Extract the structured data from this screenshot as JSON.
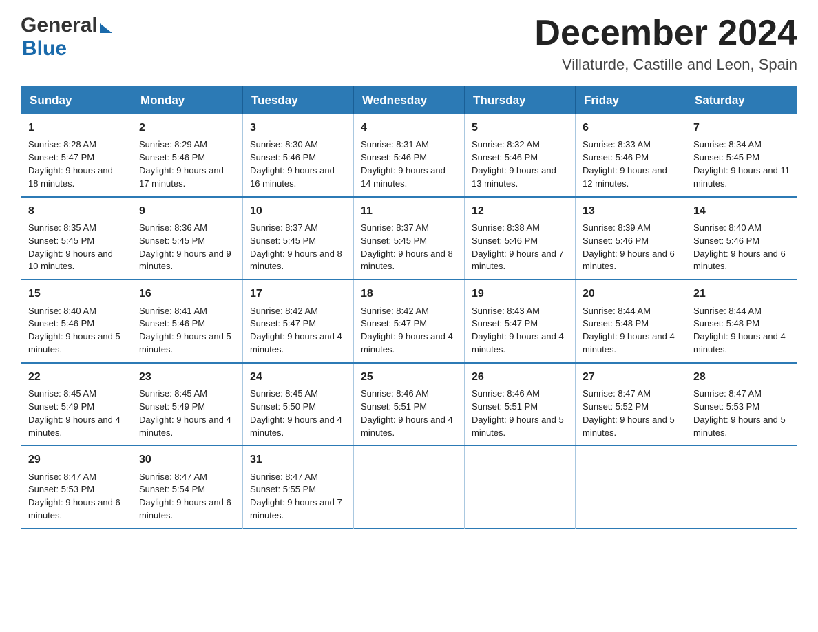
{
  "header": {
    "logo_general": "General",
    "logo_blue": "Blue",
    "month_title": "December 2024",
    "location": "Villaturde, Castille and Leon, Spain"
  },
  "weekdays": [
    "Sunday",
    "Monday",
    "Tuesday",
    "Wednesday",
    "Thursday",
    "Friday",
    "Saturday"
  ],
  "weeks": [
    [
      {
        "day": "1",
        "sunrise": "Sunrise: 8:28 AM",
        "sunset": "Sunset: 5:47 PM",
        "daylight": "Daylight: 9 hours and 18 minutes."
      },
      {
        "day": "2",
        "sunrise": "Sunrise: 8:29 AM",
        "sunset": "Sunset: 5:46 PM",
        "daylight": "Daylight: 9 hours and 17 minutes."
      },
      {
        "day": "3",
        "sunrise": "Sunrise: 8:30 AM",
        "sunset": "Sunset: 5:46 PM",
        "daylight": "Daylight: 9 hours and 16 minutes."
      },
      {
        "day": "4",
        "sunrise": "Sunrise: 8:31 AM",
        "sunset": "Sunset: 5:46 PM",
        "daylight": "Daylight: 9 hours and 14 minutes."
      },
      {
        "day": "5",
        "sunrise": "Sunrise: 8:32 AM",
        "sunset": "Sunset: 5:46 PM",
        "daylight": "Daylight: 9 hours and 13 minutes."
      },
      {
        "day": "6",
        "sunrise": "Sunrise: 8:33 AM",
        "sunset": "Sunset: 5:46 PM",
        "daylight": "Daylight: 9 hours and 12 minutes."
      },
      {
        "day": "7",
        "sunrise": "Sunrise: 8:34 AM",
        "sunset": "Sunset: 5:45 PM",
        "daylight": "Daylight: 9 hours and 11 minutes."
      }
    ],
    [
      {
        "day": "8",
        "sunrise": "Sunrise: 8:35 AM",
        "sunset": "Sunset: 5:45 PM",
        "daylight": "Daylight: 9 hours and 10 minutes."
      },
      {
        "day": "9",
        "sunrise": "Sunrise: 8:36 AM",
        "sunset": "Sunset: 5:45 PM",
        "daylight": "Daylight: 9 hours and 9 minutes."
      },
      {
        "day": "10",
        "sunrise": "Sunrise: 8:37 AM",
        "sunset": "Sunset: 5:45 PM",
        "daylight": "Daylight: 9 hours and 8 minutes."
      },
      {
        "day": "11",
        "sunrise": "Sunrise: 8:37 AM",
        "sunset": "Sunset: 5:45 PM",
        "daylight": "Daylight: 9 hours and 8 minutes."
      },
      {
        "day": "12",
        "sunrise": "Sunrise: 8:38 AM",
        "sunset": "Sunset: 5:46 PM",
        "daylight": "Daylight: 9 hours and 7 minutes."
      },
      {
        "day": "13",
        "sunrise": "Sunrise: 8:39 AM",
        "sunset": "Sunset: 5:46 PM",
        "daylight": "Daylight: 9 hours and 6 minutes."
      },
      {
        "day": "14",
        "sunrise": "Sunrise: 8:40 AM",
        "sunset": "Sunset: 5:46 PM",
        "daylight": "Daylight: 9 hours and 6 minutes."
      }
    ],
    [
      {
        "day": "15",
        "sunrise": "Sunrise: 8:40 AM",
        "sunset": "Sunset: 5:46 PM",
        "daylight": "Daylight: 9 hours and 5 minutes."
      },
      {
        "day": "16",
        "sunrise": "Sunrise: 8:41 AM",
        "sunset": "Sunset: 5:46 PM",
        "daylight": "Daylight: 9 hours and 5 minutes."
      },
      {
        "day": "17",
        "sunrise": "Sunrise: 8:42 AM",
        "sunset": "Sunset: 5:47 PM",
        "daylight": "Daylight: 9 hours and 4 minutes."
      },
      {
        "day": "18",
        "sunrise": "Sunrise: 8:42 AM",
        "sunset": "Sunset: 5:47 PM",
        "daylight": "Daylight: 9 hours and 4 minutes."
      },
      {
        "day": "19",
        "sunrise": "Sunrise: 8:43 AM",
        "sunset": "Sunset: 5:47 PM",
        "daylight": "Daylight: 9 hours and 4 minutes."
      },
      {
        "day": "20",
        "sunrise": "Sunrise: 8:44 AM",
        "sunset": "Sunset: 5:48 PM",
        "daylight": "Daylight: 9 hours and 4 minutes."
      },
      {
        "day": "21",
        "sunrise": "Sunrise: 8:44 AM",
        "sunset": "Sunset: 5:48 PM",
        "daylight": "Daylight: 9 hours and 4 minutes."
      }
    ],
    [
      {
        "day": "22",
        "sunrise": "Sunrise: 8:45 AM",
        "sunset": "Sunset: 5:49 PM",
        "daylight": "Daylight: 9 hours and 4 minutes."
      },
      {
        "day": "23",
        "sunrise": "Sunrise: 8:45 AM",
        "sunset": "Sunset: 5:49 PM",
        "daylight": "Daylight: 9 hours and 4 minutes."
      },
      {
        "day": "24",
        "sunrise": "Sunrise: 8:45 AM",
        "sunset": "Sunset: 5:50 PM",
        "daylight": "Daylight: 9 hours and 4 minutes."
      },
      {
        "day": "25",
        "sunrise": "Sunrise: 8:46 AM",
        "sunset": "Sunset: 5:51 PM",
        "daylight": "Daylight: 9 hours and 4 minutes."
      },
      {
        "day": "26",
        "sunrise": "Sunrise: 8:46 AM",
        "sunset": "Sunset: 5:51 PM",
        "daylight": "Daylight: 9 hours and 5 minutes."
      },
      {
        "day": "27",
        "sunrise": "Sunrise: 8:47 AM",
        "sunset": "Sunset: 5:52 PM",
        "daylight": "Daylight: 9 hours and 5 minutes."
      },
      {
        "day": "28",
        "sunrise": "Sunrise: 8:47 AM",
        "sunset": "Sunset: 5:53 PM",
        "daylight": "Daylight: 9 hours and 5 minutes."
      }
    ],
    [
      {
        "day": "29",
        "sunrise": "Sunrise: 8:47 AM",
        "sunset": "Sunset: 5:53 PM",
        "daylight": "Daylight: 9 hours and 6 minutes."
      },
      {
        "day": "30",
        "sunrise": "Sunrise: 8:47 AM",
        "sunset": "Sunset: 5:54 PM",
        "daylight": "Daylight: 9 hours and 6 minutes."
      },
      {
        "day": "31",
        "sunrise": "Sunrise: 8:47 AM",
        "sunset": "Sunset: 5:55 PM",
        "daylight": "Daylight: 9 hours and 7 minutes."
      },
      null,
      null,
      null,
      null
    ]
  ]
}
